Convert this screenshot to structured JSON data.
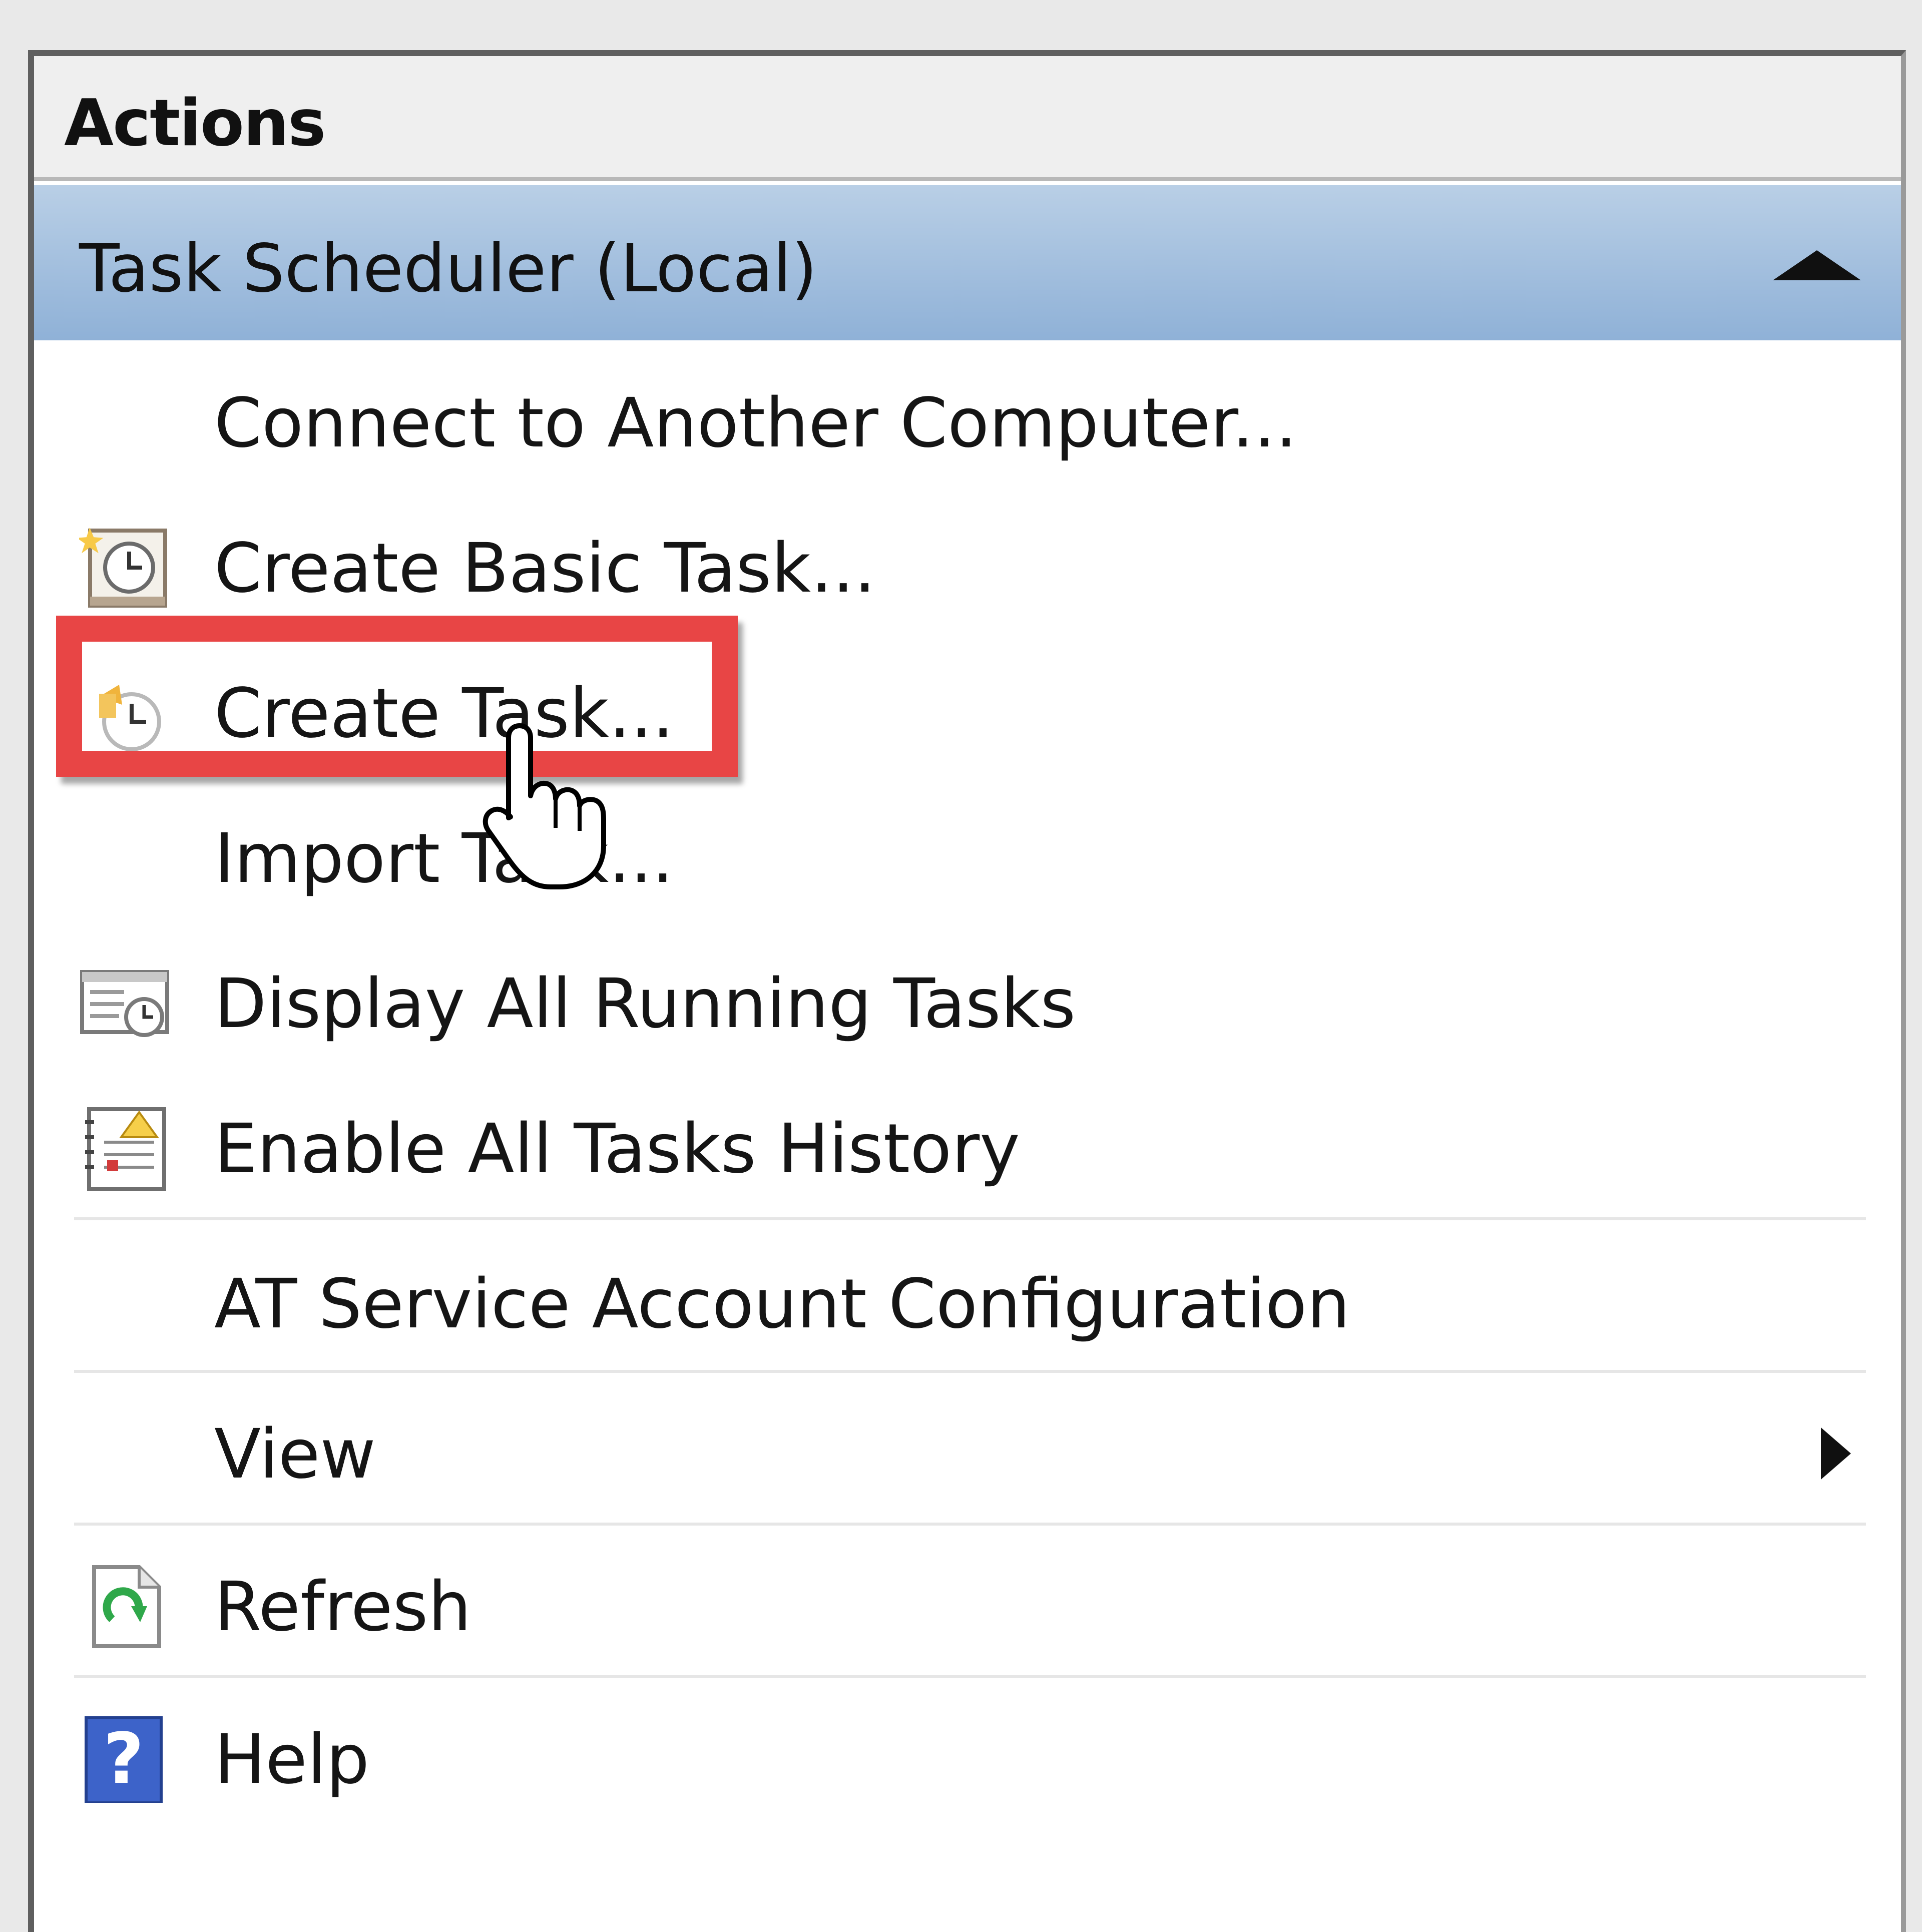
{
  "panel": {
    "title": "Actions",
    "group": {
      "title": "Task Scheduler (Local)",
      "expanded": true
    },
    "items": [
      {
        "label": "Connect to Another Computer...",
        "icon": "none"
      },
      {
        "label": "Create Basic Task...",
        "icon": "create-basic-task-icon"
      },
      {
        "label": "Create Task...",
        "icon": "create-task-icon",
        "highlighted": true
      },
      {
        "label": "Import Task...",
        "icon": "none"
      },
      {
        "label": "Display All Running Tasks",
        "icon": "running-tasks-icon"
      },
      {
        "label": "Enable All Tasks History",
        "icon": "tasks-history-icon"
      },
      {
        "label": "AT Service Account Configuration",
        "icon": "none"
      },
      {
        "label": "View",
        "icon": "none",
        "submenu": true
      },
      {
        "label": "Refresh",
        "icon": "refresh-icon"
      },
      {
        "label": "Help",
        "icon": "help-icon"
      }
    ]
  },
  "colors": {
    "highlight": "#e84545",
    "group_header": "#a6c1e0"
  }
}
